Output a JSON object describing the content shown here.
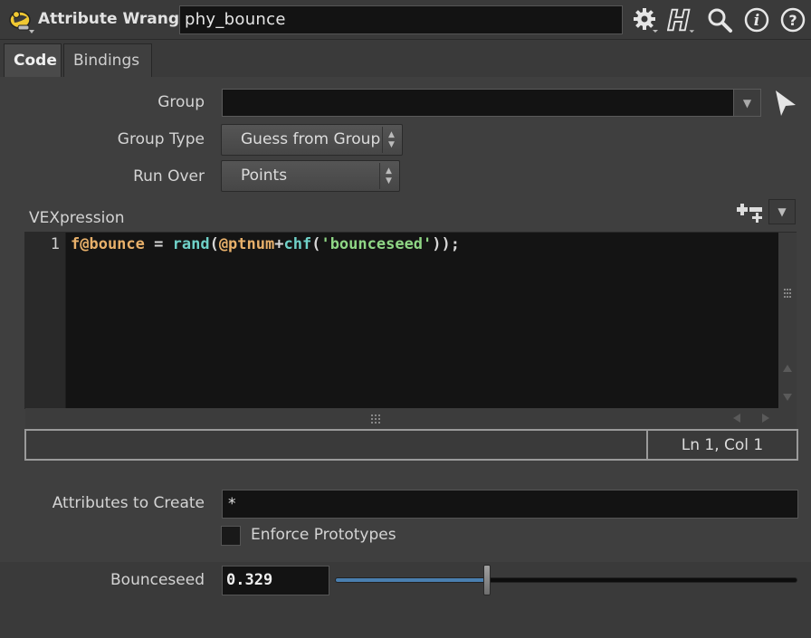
{
  "header": {
    "node_type": "Attribute Wrangle",
    "node_name": "phy_bounce",
    "icons": [
      "wrangle-node-icon",
      "gear-icon",
      "houdini-help-icon",
      "search-icon",
      "info-icon",
      "help-icon"
    ]
  },
  "tabs": [
    {
      "label": "Code",
      "active": true
    },
    {
      "label": "Bindings",
      "active": false
    }
  ],
  "params": {
    "group_label": "Group",
    "group_value": "",
    "group_type_label": "Group Type",
    "group_type_value": "Guess from Group",
    "run_over_label": "Run Over",
    "run_over_value": "Points",
    "vex_label": "VEXpression",
    "attrs_label": "Attributes to Create",
    "attrs_value": "*",
    "enforce_label": "Enforce Prototypes",
    "enforce_checked": false,
    "seed_label": "Bounceseed",
    "seed_value": "0.329",
    "seed_fraction": 0.329
  },
  "editor": {
    "line_number": "1",
    "tokens": {
      "t1": "f@bounce",
      "t2": " = ",
      "t3": "rand",
      "t4": "(",
      "t5": "@ptnum",
      "t6": "+",
      "t7": "chf",
      "t8": "(",
      "t9": "'bounceseed'",
      "t10": "));"
    },
    "status": "Ln 1, Col 1"
  },
  "colors": {
    "background": "#3a3a3a",
    "panel": "#3f3f3f",
    "field": "#131313",
    "attr_token": "#e8b06a",
    "func_token": "#6fd1c8",
    "string_token": "#8fd685",
    "slider_fill": "#4a7fb0"
  }
}
